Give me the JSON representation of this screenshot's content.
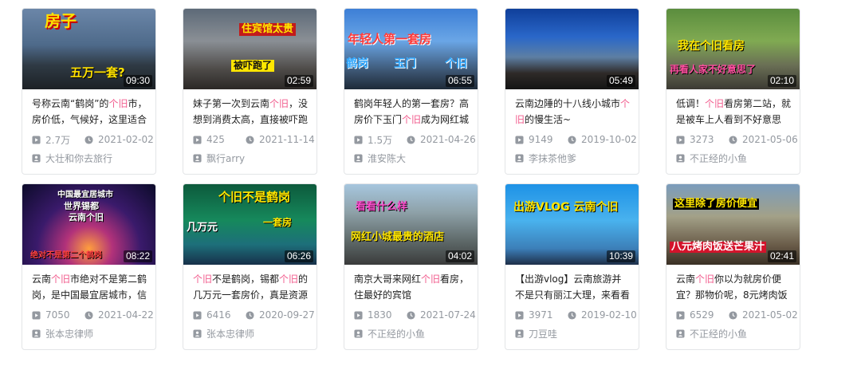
{
  "videos": [
    {
      "duration": "09:30",
      "title_parts": [
        "号称云南“鹤岗”的",
        "个旧",
        "市，房价低，气候好，这里适合"
      ],
      "views": "2.7万",
      "date": "2021-02-02",
      "uploader": "大壮和你去旅行",
      "overlays": [
        "房子",
        "五万一套?"
      ]
    },
    {
      "duration": "02:59",
      "title_parts": [
        "妹子第一次到云南",
        "个旧",
        "，没想到消费太高，直接被吓跑"
      ],
      "views": "425",
      "date": "2021-11-14",
      "uploader": "飘行arry",
      "overlays": [
        "住宾馆太贵",
        "被吓跑了"
      ]
    },
    {
      "duration": "06:55",
      "title_parts": [
        "鹤岗年轻人的第一套房？高房价下玉门",
        "个旧",
        "成为网红城"
      ],
      "views": "1.5万",
      "date": "2021-04-26",
      "uploader": "淮安陈大",
      "overlays": [
        "年轻人第一套房",
        "鹤岗",
        "玉门",
        "个旧"
      ]
    },
    {
      "duration": "05:49",
      "title_parts": [
        "云南边陲的十八线小城市",
        "个旧",
        "的慢生活~"
      ],
      "views": "9149",
      "date": "2019-10-02",
      "uploader": "李抹茶他爹",
      "overlays": []
    },
    {
      "duration": "02:10",
      "title_parts": [
        "低调！",
        "个旧",
        "看房第二站，就是被车上人看到不好意思"
      ],
      "views": "3273",
      "date": "2021-05-06",
      "uploader": "不正经的小鱼",
      "overlays": [
        "我在个旧看房",
        "再看人家不好意思了"
      ]
    },
    {
      "duration": "08:22",
      "title_parts": [
        "云南",
        "个旧",
        "市绝对不是第二鹤岗，是中国最宜居城市，信"
      ],
      "views": "7050",
      "date": "2021-04-22",
      "uploader": "张本忠律师",
      "overlays": [
        "中国最宜居城市",
        "世界锡都",
        "云南个旧",
        "绝对不是第二个鹤岗"
      ]
    },
    {
      "duration": "06:26",
      "title_parts": [
        "",
        "个旧",
        "不是鹤岗，锡都",
        "个旧",
        "的几万元一套房价，真是资源"
      ],
      "views": "6416",
      "date": "2020-09-27",
      "uploader": "张本忠律师",
      "overlays": [
        "个旧不是鹤岗",
        "几万元",
        "一套房"
      ]
    },
    {
      "duration": "04:02",
      "title_parts": [
        "南京大哥来网红",
        "个旧",
        "看房，住最好的宾馆"
      ],
      "views": "1830",
      "date": "2021-07-24",
      "uploader": "不正经的小鱼",
      "overlays": [
        "看看什么样",
        "网红小城最贵的酒店"
      ]
    },
    {
      "duration": "10:39",
      "title_parts": [
        "【出游vlog】云南旅游并不是只有丽江大理，来看看我"
      ],
      "views": "3971",
      "date": "2019-02-10",
      "uploader": "刀豆哇",
      "overlays": [
        "出游VLOG 云南个旧"
      ]
    },
    {
      "duration": "02:41",
      "title_parts": [
        "云南",
        "个旧",
        "你以为就房价便宜？那物价呢，8元烤肉饭"
      ],
      "views": "6529",
      "date": "2021-05-02",
      "uploader": "不正经的小鱼",
      "overlays": [
        "这里除了房价便宜",
        "八元烤肉饭送芒果汁"
      ]
    }
  ],
  "icons": {
    "play": "play-count-icon",
    "clock": "clock-icon",
    "uploader": "uploader-icon"
  },
  "colors": {
    "highlight": "#f25d8e",
    "meta": "#9499a0",
    "border": "#e3e5e7"
  }
}
